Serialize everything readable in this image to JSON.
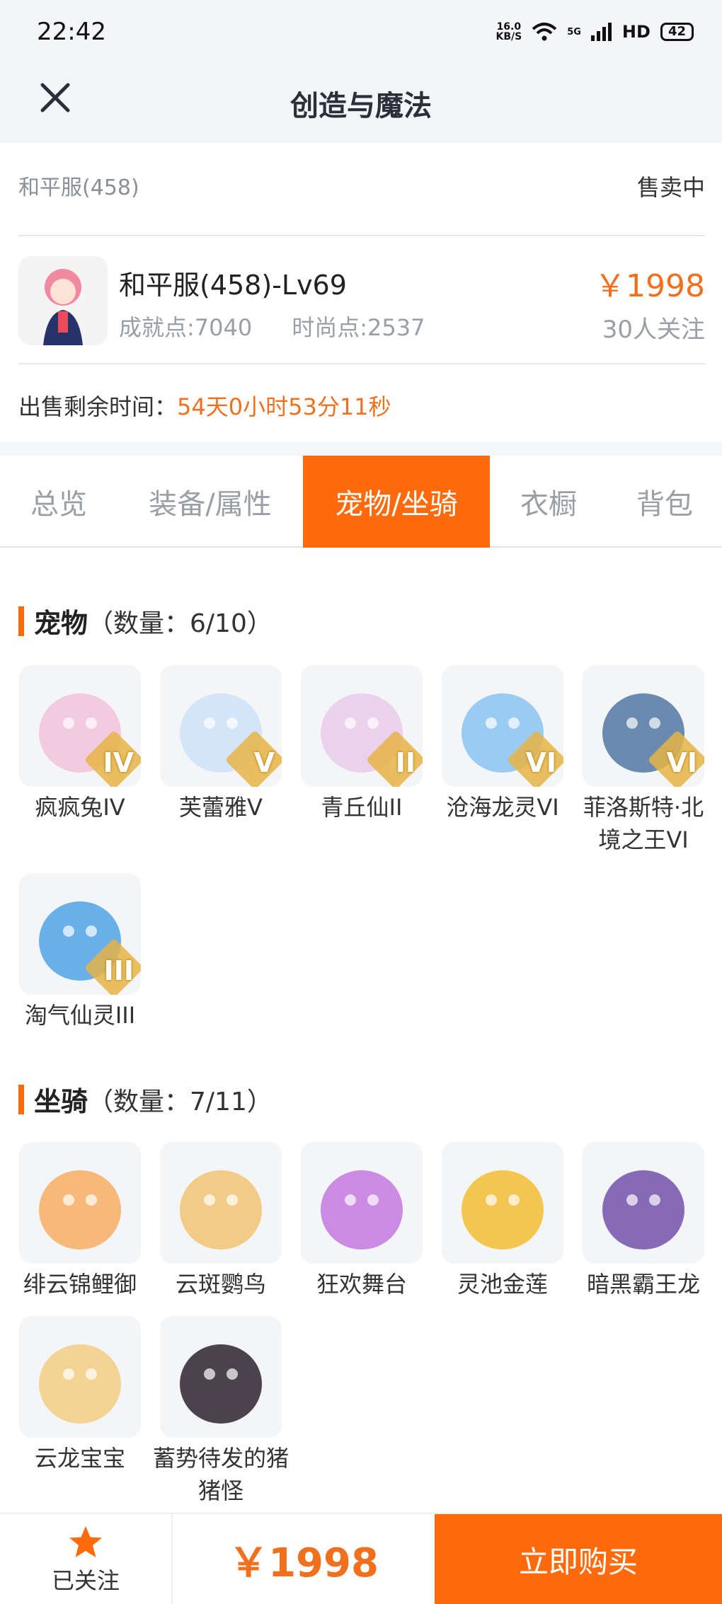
{
  "status_bar": {
    "time": "22:42",
    "net_speed_top": "16.0",
    "net_speed_bottom": "KB/S",
    "network": "5G",
    "hd": "HD",
    "battery": "42"
  },
  "header": {
    "title": "创造与魔法"
  },
  "summary": {
    "server": "和平服(458)",
    "status": "售卖中",
    "char_name": "和平服(458)-Lv69",
    "achievement": "成就点:7040",
    "fashion": "时尚点:2537",
    "price": "￥1998",
    "followers": "30人关注",
    "remain_label": "出售剩余时间：",
    "remain_value": "54天0小时53分11秒"
  },
  "tabs": [
    {
      "label": "总览"
    },
    {
      "label": "装备/属性"
    },
    {
      "label": "宠物/坐骑"
    },
    {
      "label": "衣橱"
    },
    {
      "label": "背包"
    }
  ],
  "pets": {
    "title": "宠物",
    "count": "（数量：6/10）",
    "items": [
      {
        "name": "疯疯兔IV",
        "rank": "IV",
        "color": "#f3c7dc"
      },
      {
        "name": "芙蕾雅V",
        "rank": "V",
        "color": "#cfe3f7"
      },
      {
        "name": "青丘仙II",
        "rank": "II",
        "color": "#e9cdea"
      },
      {
        "name": "沧海龙灵VI",
        "rank": "VI",
        "color": "#8fc7f2"
      },
      {
        "name": "菲洛斯特·北境之王VI",
        "rank": "VI",
        "color": "#5b7fa6"
      },
      {
        "name": "淘气仙灵III",
        "rank": "III",
        "color": "#5aa9e8"
      }
    ]
  },
  "mounts": {
    "title": "坐骑",
    "count": "（数量：7/11）",
    "items": [
      {
        "name": "绯云锦鲤御",
        "color": "#f7b26a"
      },
      {
        "name": "云斑鹦鸟",
        "color": "#f2c87a"
      },
      {
        "name": "狂欢舞台",
        "color": "#c67ee0"
      },
      {
        "name": "灵池金莲",
        "color": "#f3c23c"
      },
      {
        "name": "暗黑霸王龙",
        "color": "#7a5bb0"
      },
      {
        "name": "云龙宝宝",
        "color": "#f4d08a"
      },
      {
        "name": "蓄势待发的猪猪怪",
        "color": "#3a2f3a"
      }
    ]
  },
  "bottom": {
    "follow_label": "已关注",
    "price": "￥1998",
    "buy_label": "立即购买"
  },
  "colors": {
    "accent": "#ff6a0c",
    "price": "#f0701e"
  }
}
